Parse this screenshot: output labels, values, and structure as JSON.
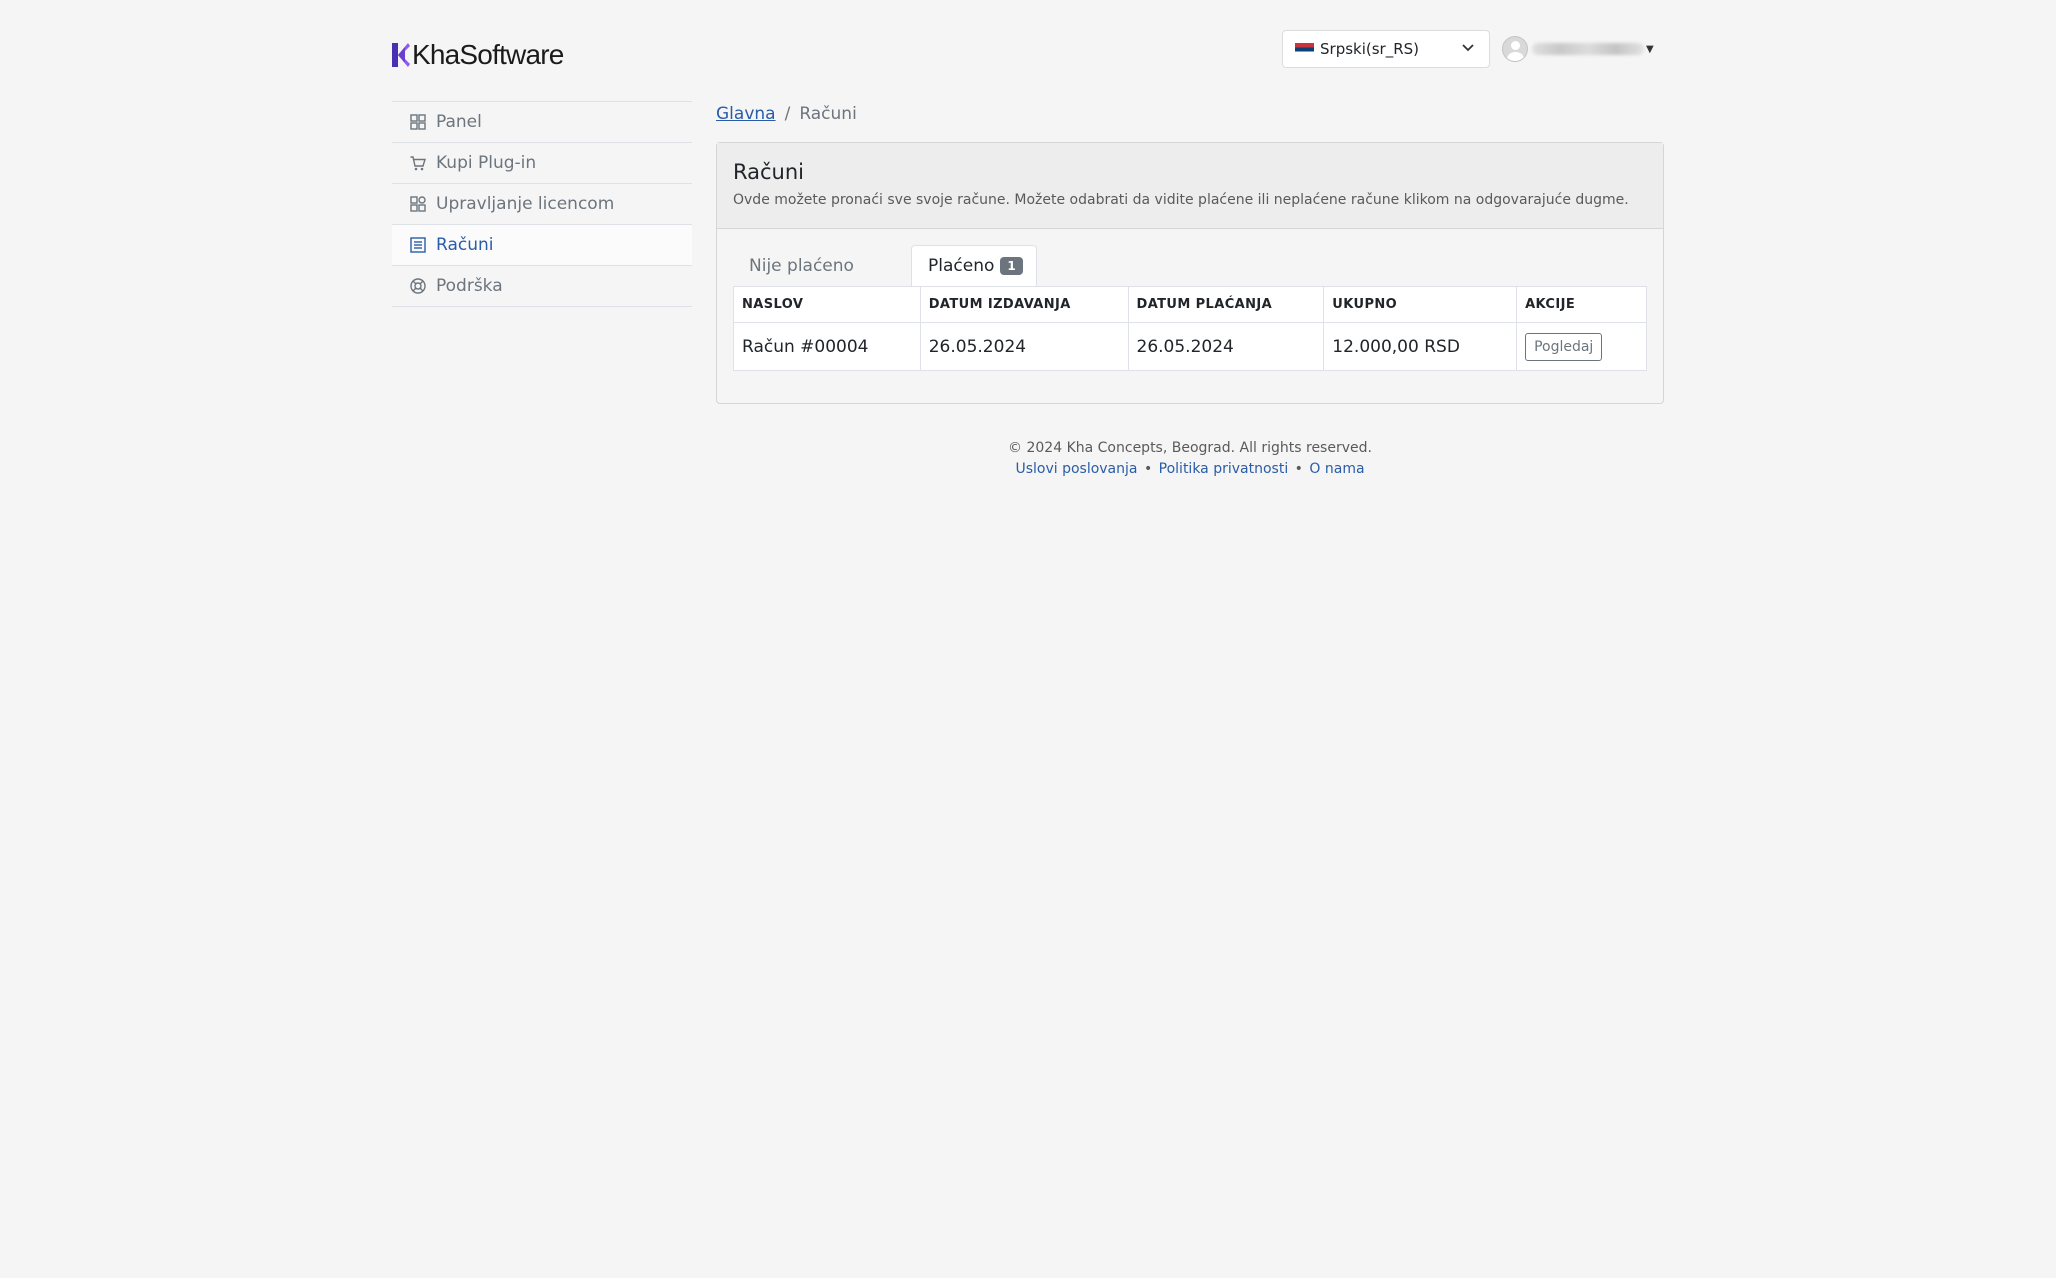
{
  "header": {
    "logo_text": "KhaSoftware",
    "language": "Srpski(sr_RS)"
  },
  "sidebar": {
    "items": [
      {
        "label": "Panel",
        "icon": "grid-icon"
      },
      {
        "label": "Kupi Plug-in",
        "icon": "cart-icon"
      },
      {
        "label": "Upravljanje licencom",
        "icon": "apps-icon"
      },
      {
        "label": "Računi",
        "icon": "list-icon",
        "active": true
      },
      {
        "label": "Podrška",
        "icon": "lifebuoy-icon"
      }
    ]
  },
  "breadcrumb": {
    "home": "Glavna",
    "separator": "/",
    "current": "Računi"
  },
  "card": {
    "title": "Računi",
    "description": "Ovde možete pronaći sve svoje račune. Možete odabrati da vidite plaćene ili neplaćene račune klikom na odgovarajuće dugme."
  },
  "tabs": [
    {
      "label": "Nije plaćeno"
    },
    {
      "label": "Plaćeno",
      "badge": "1",
      "active": true
    }
  ],
  "table": {
    "headers": [
      "NASLOV",
      "DATUM IZDAVANJA",
      "DATUM PLAĆANJA",
      "UKUPNO",
      "AKCIJE"
    ],
    "rows": [
      {
        "title": "Račun #00004",
        "issued": "26.05.2024",
        "paid": "26.05.2024",
        "total": "12.000,00 RSD",
        "action": "Pogledaj"
      }
    ]
  },
  "footer": {
    "copyright": "© 2024 Kha Concepts, Beograd. All rights reserved.",
    "links": [
      "Uslovi poslovanja",
      "Politika privatnosti",
      "O nama"
    ],
    "separator": "•"
  },
  "colors": {
    "accent": "#2a5ca8",
    "logo_purple": "#6a3fd0",
    "background": "#f5f5f5"
  }
}
